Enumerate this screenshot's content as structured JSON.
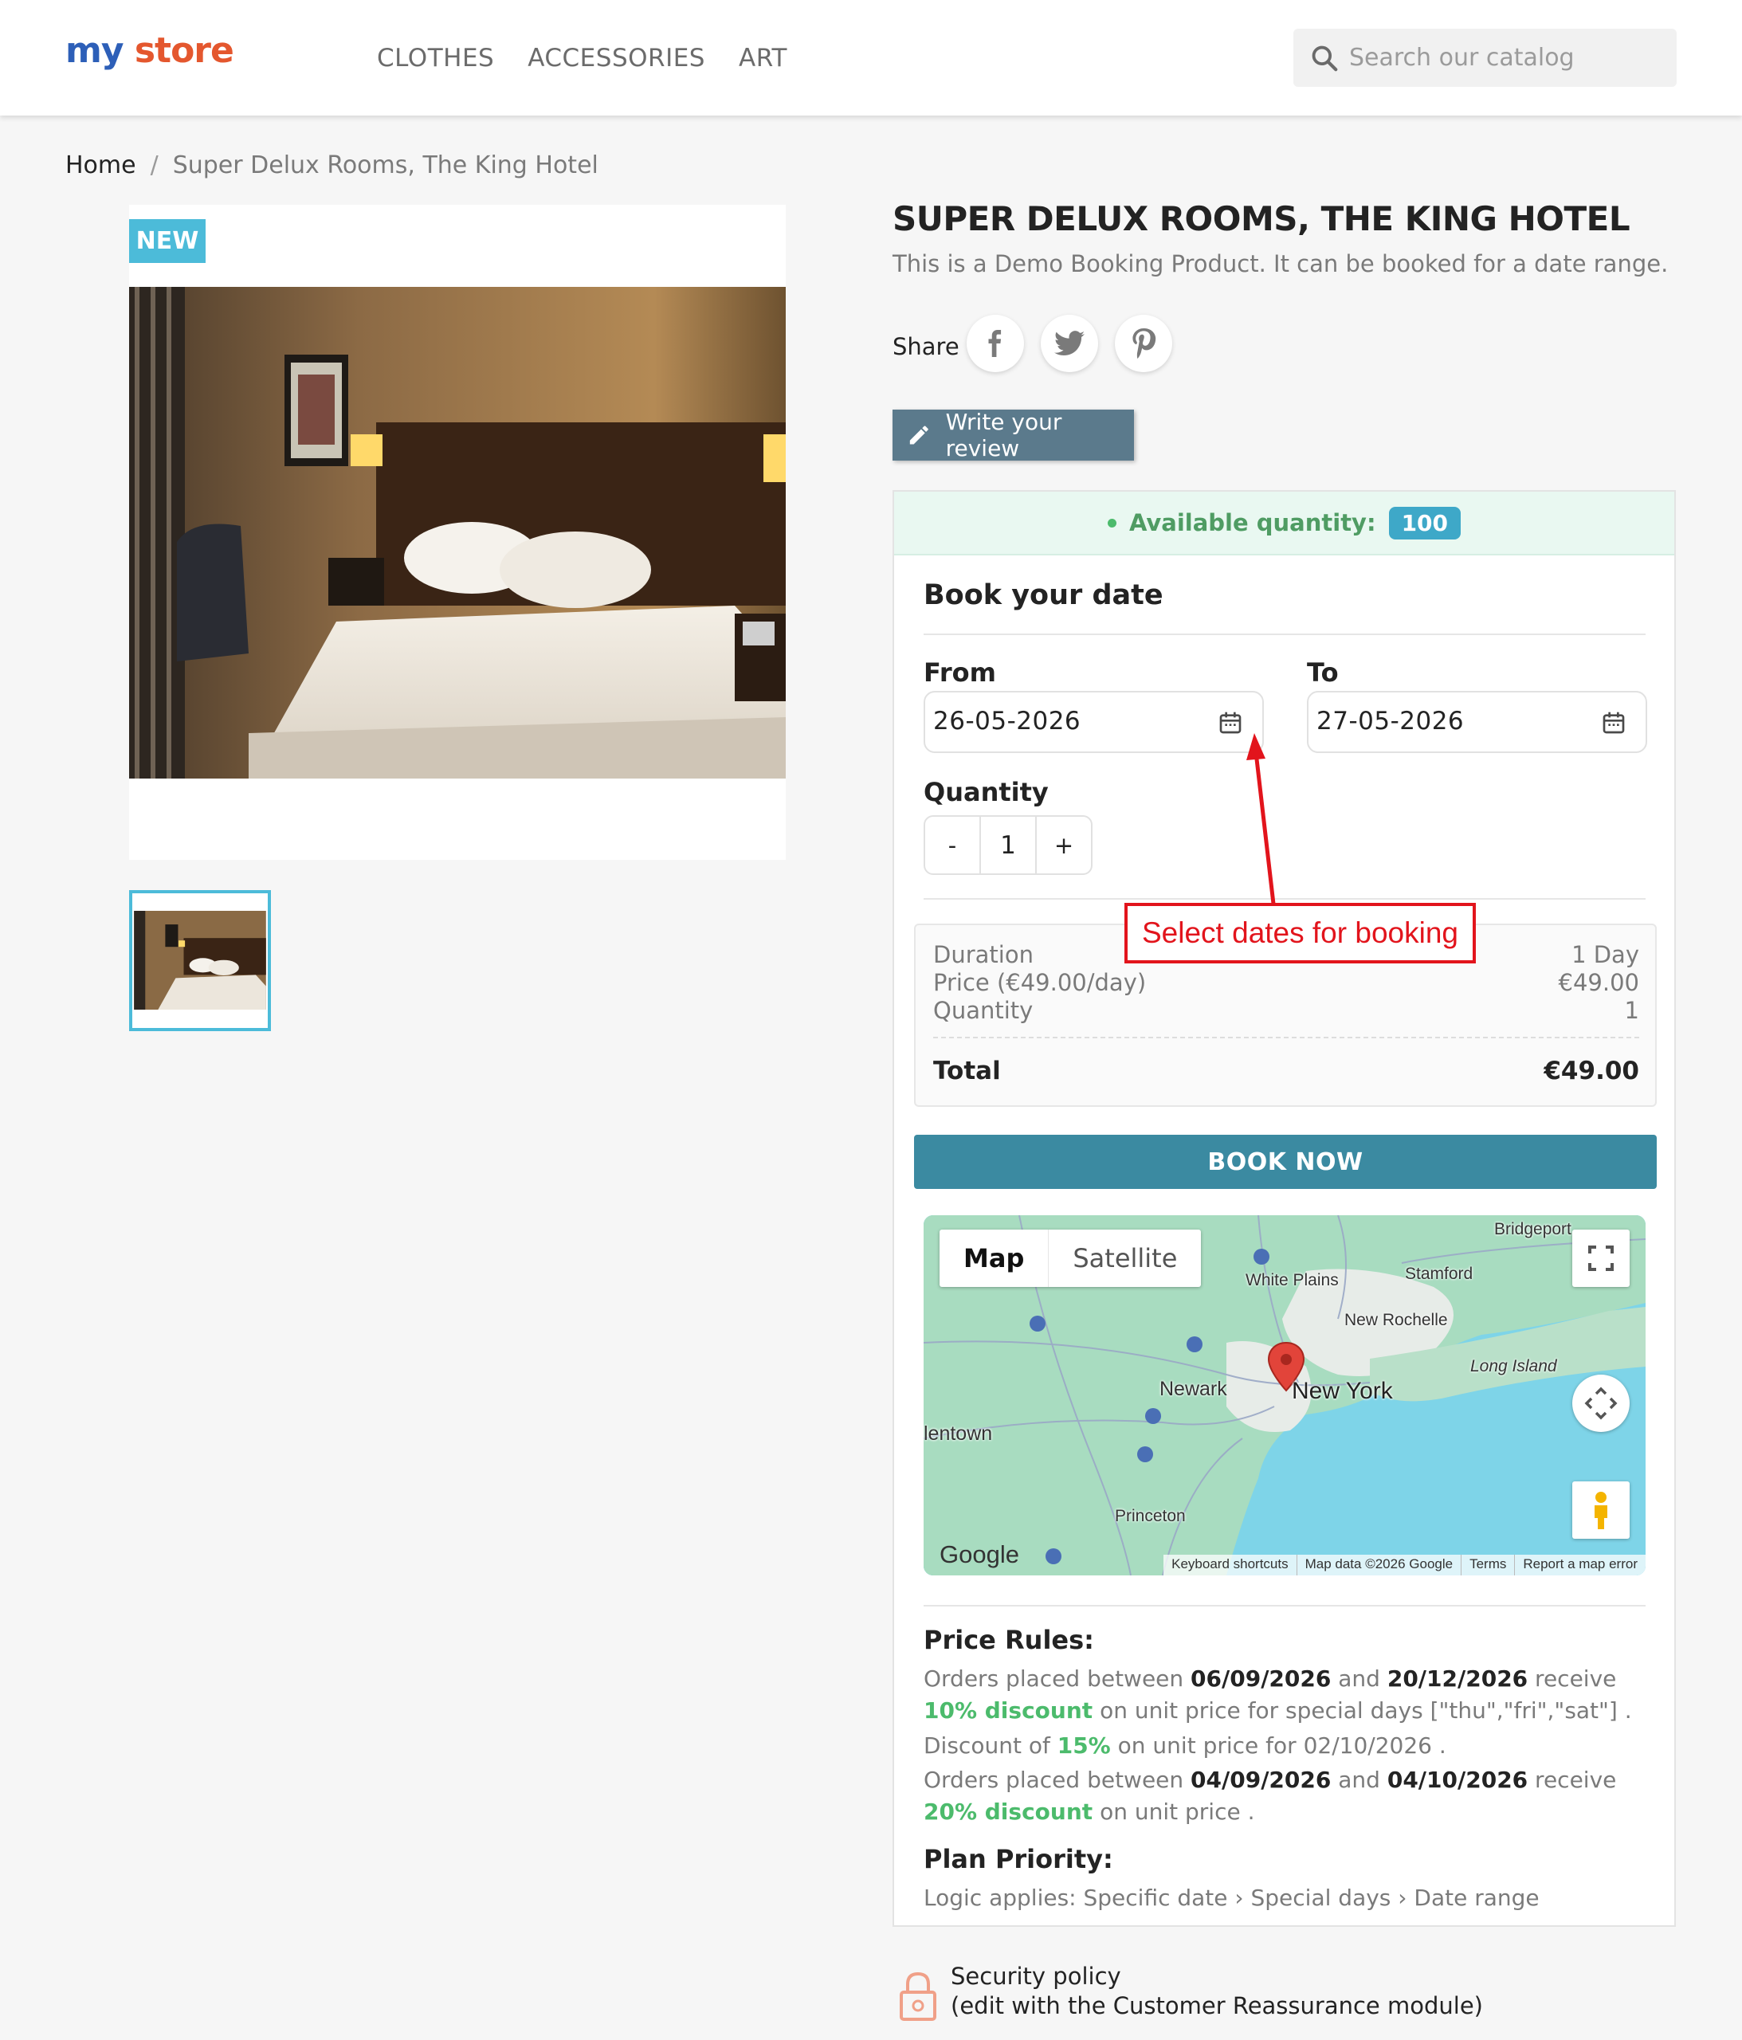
{
  "header": {
    "logo_part1": "my",
    "logo_part2": "store",
    "nav": [
      "CLOTHES",
      "ACCESSORIES",
      "ART"
    ],
    "search_placeholder": "Search our catalog"
  },
  "breadcrumb": {
    "home": "Home",
    "separator": "/",
    "current": "Super Delux Rooms, The King Hotel"
  },
  "product": {
    "badge": "NEW",
    "title": "SUPER DELUX ROOMS, THE KING HOTEL",
    "description": "This is a Demo Booking Product. It can be booked for a date range.",
    "share_label": "Share",
    "share_icons": [
      "facebook-icon",
      "twitter-icon",
      "pinterest-icon"
    ],
    "review_button": "Write your review"
  },
  "booking": {
    "available_label": "Available quantity:",
    "available_qty": "100",
    "title": "Book your date",
    "from_label": "From",
    "from_value": "26-05-2026",
    "to_label": "To",
    "to_value": "27-05-2026",
    "quantity_label": "Quantity",
    "qty_minus": "-",
    "qty_value": "1",
    "qty_plus": "+",
    "summary": {
      "duration_label": "Duration",
      "duration_value": "1 Day",
      "price_label": "Price (€49.00/day)",
      "price_value": "€49.00",
      "quantity_label": "Quantity",
      "quantity_value": "1",
      "total_label": "Total",
      "total_value": "€49.00"
    },
    "book_button": "BOOK NOW"
  },
  "annotation": {
    "text": "Select dates for booking"
  },
  "map": {
    "tab_map": "Map",
    "tab_satellite": "Satellite",
    "labels": {
      "bridgeport": "Bridgeport",
      "stamford": "Stamford",
      "white_plains": "White Plains",
      "new_rochelle": "New Rochelle",
      "long_island": "Long Island",
      "newark": "Newark",
      "new_york": "New York",
      "allentown": "lentown",
      "princeton": "Princeton"
    },
    "google": "Google",
    "footer": [
      "Keyboard shortcuts",
      "Map data ©2026 Google",
      "Terms",
      "Report a map error"
    ],
    "colors": {
      "water": "#7ed4e8",
      "land": "#a8dcc0",
      "urban": "#e7ece8",
      "pin": "#e2443a"
    }
  },
  "price_rules": {
    "title": "Price Rules:",
    "rule1": {
      "t1": "Orders placed between ",
      "d1": "06/09/2026",
      "t2": " and ",
      "d2": "20/12/2026",
      "t3": " receive ",
      "g1": "10% discount",
      "t4": " on unit price for special days [\"thu\",\"fri\",\"sat\"] ."
    },
    "rule2": {
      "t1": "Discount of ",
      "g1": "15%",
      "t2": " on unit price for 02/10/2026 ."
    },
    "rule3": {
      "t1": "Orders placed between ",
      "d1": "04/09/2026",
      "t2": " and ",
      "d2": "04/10/2026",
      "t3": " receive ",
      "g1": "20% discount",
      "t4": " on unit price ."
    },
    "plan_title": "Plan Priority:",
    "plan_text": "Logic applies: Specific date › Special days › Date range"
  },
  "reassurance": {
    "line1": "Security policy",
    "line2": "(edit with the Customer Reassurance module)"
  }
}
